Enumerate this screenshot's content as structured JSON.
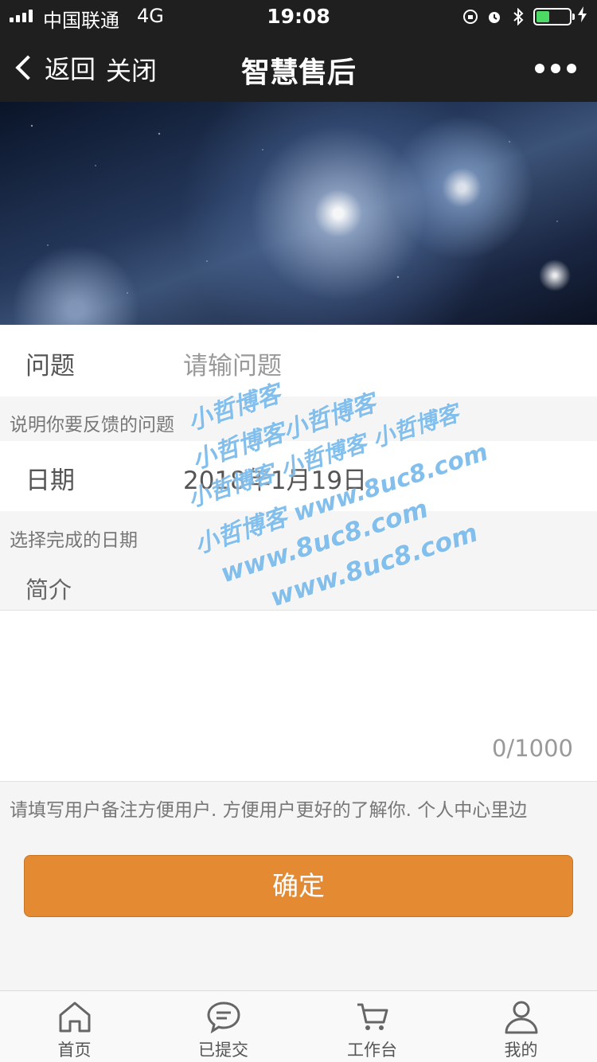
{
  "status_bar": {
    "carrier": "中国联通",
    "network": "4G",
    "time": "19:08",
    "battery_level": 0.4
  },
  "nav": {
    "back_label": "返回",
    "close_label": "关闭",
    "title": "智慧售后"
  },
  "form": {
    "question": {
      "label": "问题",
      "placeholder": "请输问题",
      "hint": "说明你要反馈的问题"
    },
    "date": {
      "label": "日期",
      "value": "2018年1月19日",
      "hint": "选择完成的日期"
    },
    "intro": {
      "label": "简介",
      "value": "",
      "counter": "0/1000"
    },
    "note": "请填写用户备注方便用户. 方便用户更好的了解你. 个人中心里边",
    "submit_label": "确定"
  },
  "watermark": {
    "lines": [
      "小哲博客",
      "小哲博客小哲博客",
      "小哲博客 小哲博客 小哲博客",
      "小哲博客 www.8uc8.com",
      "www.8uc8.com",
      "www.8uc8.com"
    ]
  },
  "tabbar": {
    "items": [
      {
        "label": "首页",
        "icon": "home-icon"
      },
      {
        "label": "已提交",
        "icon": "chat-bubble-icon"
      },
      {
        "label": "工作台",
        "icon": "cart-icon"
      },
      {
        "label": "我的",
        "icon": "user-icon"
      }
    ]
  },
  "colors": {
    "accent": "#e48a33",
    "nav_bg": "#1f1f1f",
    "page_bg": "#f5f5f5",
    "watermark": "#5aaae6"
  }
}
